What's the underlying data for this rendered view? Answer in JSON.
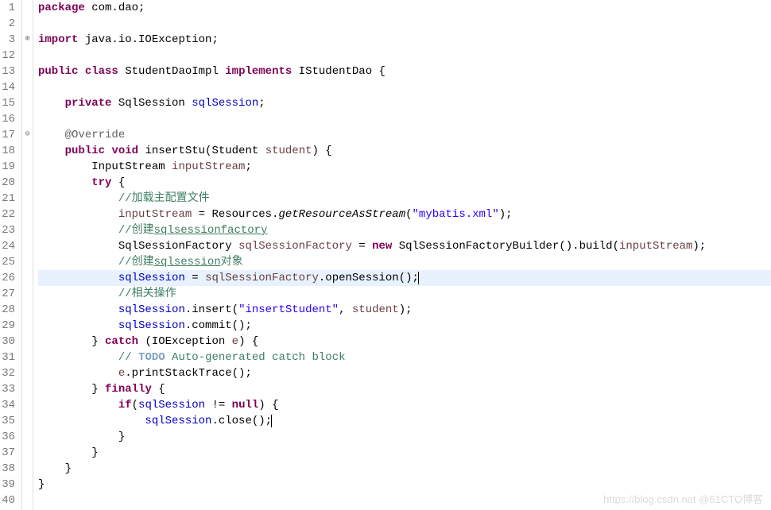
{
  "lines": [
    {
      "num": "1",
      "fold": ""
    },
    {
      "num": "2",
      "fold": ""
    },
    {
      "num": "3",
      "fold": "⊕"
    },
    {
      "num": "12",
      "fold": ""
    },
    {
      "num": "13",
      "fold": ""
    },
    {
      "num": "14",
      "fold": ""
    },
    {
      "num": "15",
      "fold": ""
    },
    {
      "num": "16",
      "fold": ""
    },
    {
      "num": "17",
      "fold": "⊖"
    },
    {
      "num": "18",
      "fold": ""
    },
    {
      "num": "19",
      "fold": ""
    },
    {
      "num": "20",
      "fold": ""
    },
    {
      "num": "21",
      "fold": ""
    },
    {
      "num": "22",
      "fold": ""
    },
    {
      "num": "23",
      "fold": ""
    },
    {
      "num": "24",
      "fold": ""
    },
    {
      "num": "25",
      "fold": ""
    },
    {
      "num": "26",
      "fold": ""
    },
    {
      "num": "27",
      "fold": ""
    },
    {
      "num": "28",
      "fold": ""
    },
    {
      "num": "29",
      "fold": ""
    },
    {
      "num": "30",
      "fold": ""
    },
    {
      "num": "31",
      "fold": ""
    },
    {
      "num": "32",
      "fold": ""
    },
    {
      "num": "33",
      "fold": ""
    },
    {
      "num": "34",
      "fold": ""
    },
    {
      "num": "35",
      "fold": ""
    },
    {
      "num": "36",
      "fold": ""
    },
    {
      "num": "37",
      "fold": ""
    },
    {
      "num": "38",
      "fold": ""
    },
    {
      "num": "39",
      "fold": ""
    },
    {
      "num": "40",
      "fold": ""
    }
  ],
  "code": {
    "l1": {
      "kw1": "package",
      "txt": " com.dao;"
    },
    "l3": {
      "kw1": "import",
      "txt": " java.io.IOException;"
    },
    "l13": {
      "kw1": "public",
      "kw2": "class",
      "name": " StudentDaoImpl ",
      "kw3": "implements",
      "impl": " IStudentDao {"
    },
    "l15": {
      "kw1": "private",
      "type": " SqlSession ",
      "field": "sqlSession",
      "end": ";"
    },
    "l17": {
      "ann": "@Override"
    },
    "l18": {
      "kw1": "public",
      "kw2": "void",
      "name": " insertStu(Student ",
      "param": "student",
      "end": ") {"
    },
    "l19": {
      "type": "InputStream ",
      "var": "inputStream",
      "end": ";"
    },
    "l20": {
      "kw1": "try",
      "end": " {"
    },
    "l21": {
      "cmt": "//加载主配置文件"
    },
    "l22": {
      "var": "inputStream",
      "eq": " = Resources.",
      "static": "getResourceAsStream",
      "call": "(",
      "str": "\"mybatis.xml\"",
      "end": ");"
    },
    "l23": {
      "cmt1": "//创建",
      "cmtlink": "sqlsessionfactory"
    },
    "l24": {
      "type": "SqlSessionFactory ",
      "var": "sqlSessionFactory",
      "eq": " = ",
      "kw1": "new",
      "ctor": " SqlSessionFactoryBuilder().build(",
      "param": "inputStream",
      "end": ");"
    },
    "l25": {
      "cmt1": "//创建",
      "cmtlink": "sqlsession",
      "cmt2": "对象"
    },
    "l26": {
      "field": "sqlSession",
      "eq": " = ",
      "var": "sqlSessionFactory",
      "call": ".openSession();"
    },
    "l27": {
      "cmt": "//相关操作"
    },
    "l28": {
      "field": "sqlSession",
      "call": ".insert(",
      "str": "\"insertStudent\"",
      "mid": ", ",
      "param": "student",
      "end": ");"
    },
    "l29": {
      "field": "sqlSession",
      "call": ".commit();"
    },
    "l30": {
      "close": "} ",
      "kw1": "catch",
      "param": " (IOException ",
      "var": "e",
      "end": ") {"
    },
    "l31": {
      "cmt1": "// ",
      "todo": "TODO",
      "cmt2": " Auto-generated catch block"
    },
    "l32": {
      "var": "e",
      "call": ".printStackTrace();"
    },
    "l33": {
      "close": "} ",
      "kw1": "finally",
      "end": " {"
    },
    "l34": {
      "kw1": "if",
      "open": "(",
      "field": "sqlSession",
      "cond": " != ",
      "kw2": "null",
      "end": ") {"
    },
    "l35": {
      "field": "sqlSession",
      "call": ".close();"
    },
    "l36": {
      "close": "}"
    },
    "l37": {
      "close": "}"
    },
    "l38": {
      "close": "}"
    },
    "l39": {
      "close": "}"
    }
  },
  "watermark": "https://blog.csdn.net @51CTO博客"
}
